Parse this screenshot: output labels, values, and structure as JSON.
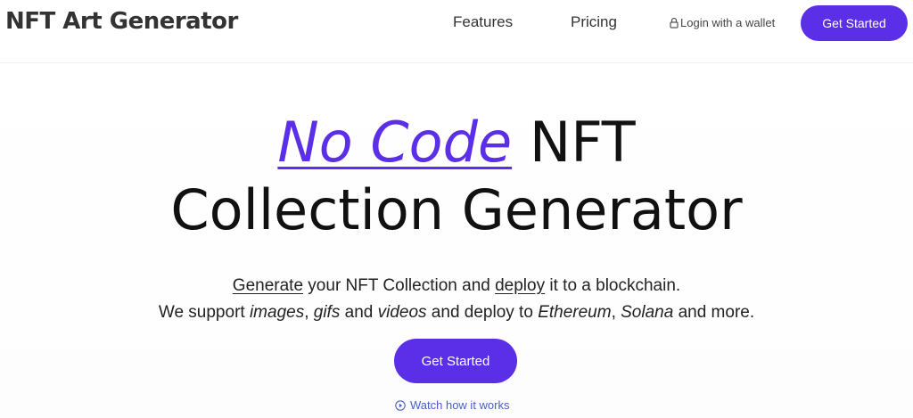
{
  "nav": {
    "brand": "NFT Art Generator",
    "features": "Features",
    "pricing": "Pricing",
    "login": "Login with a wallet",
    "cta": "Get Started"
  },
  "hero": {
    "headline_accent": "No Code",
    "headline_rest1": " NFT",
    "headline_line2": "Collection Generator",
    "sub_line1": {
      "w1": "Generate",
      "t1": " your NFT Collection and ",
      "w2": "deploy",
      "t2": " it to a blockchain."
    },
    "sub_line2": {
      "t1": "We support ",
      "i1": "images",
      "t2": ", ",
      "i2": "gifs",
      "t3": " and ",
      "i3": "videos",
      "t4": " and deploy to ",
      "i4": "Ethereum",
      "t5": ", ",
      "i5": "Solana",
      "t6": " and more."
    },
    "cta": "Get Started",
    "watch": "Watch how it works"
  },
  "colors": {
    "accent": "#5b2ee8",
    "link": "#4a5ec8"
  },
  "icons": {
    "login": "lock-icon",
    "watch": "play-circle-icon"
  }
}
